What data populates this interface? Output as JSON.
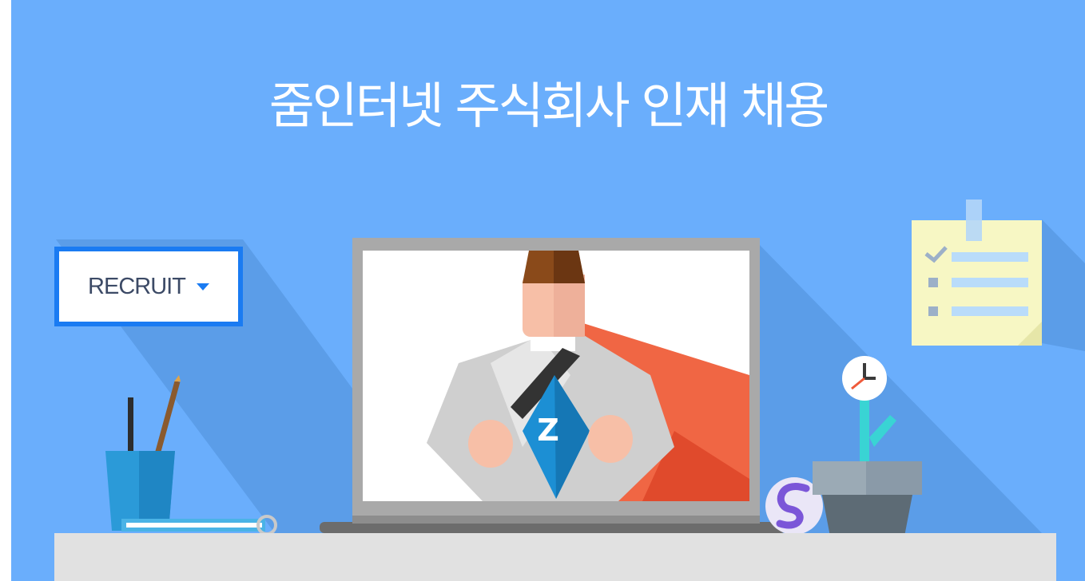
{
  "banner": {
    "title": "줌인터넷 주식회사 인재 채용",
    "background_color": "#6aaefc",
    "accent_color": "#1a7bf2"
  },
  "recruit_dropdown": {
    "label": "RECRUIT",
    "icon": "caret-down-icon"
  },
  "illustration": {
    "laptop_logo": "Z",
    "icons": [
      "laptop-icon",
      "superhero-icon",
      "pencil-cup-icon",
      "checklist-note-icon",
      "clock-icon",
      "plant-pot-icon",
      "swing-logo-ball-icon"
    ]
  }
}
